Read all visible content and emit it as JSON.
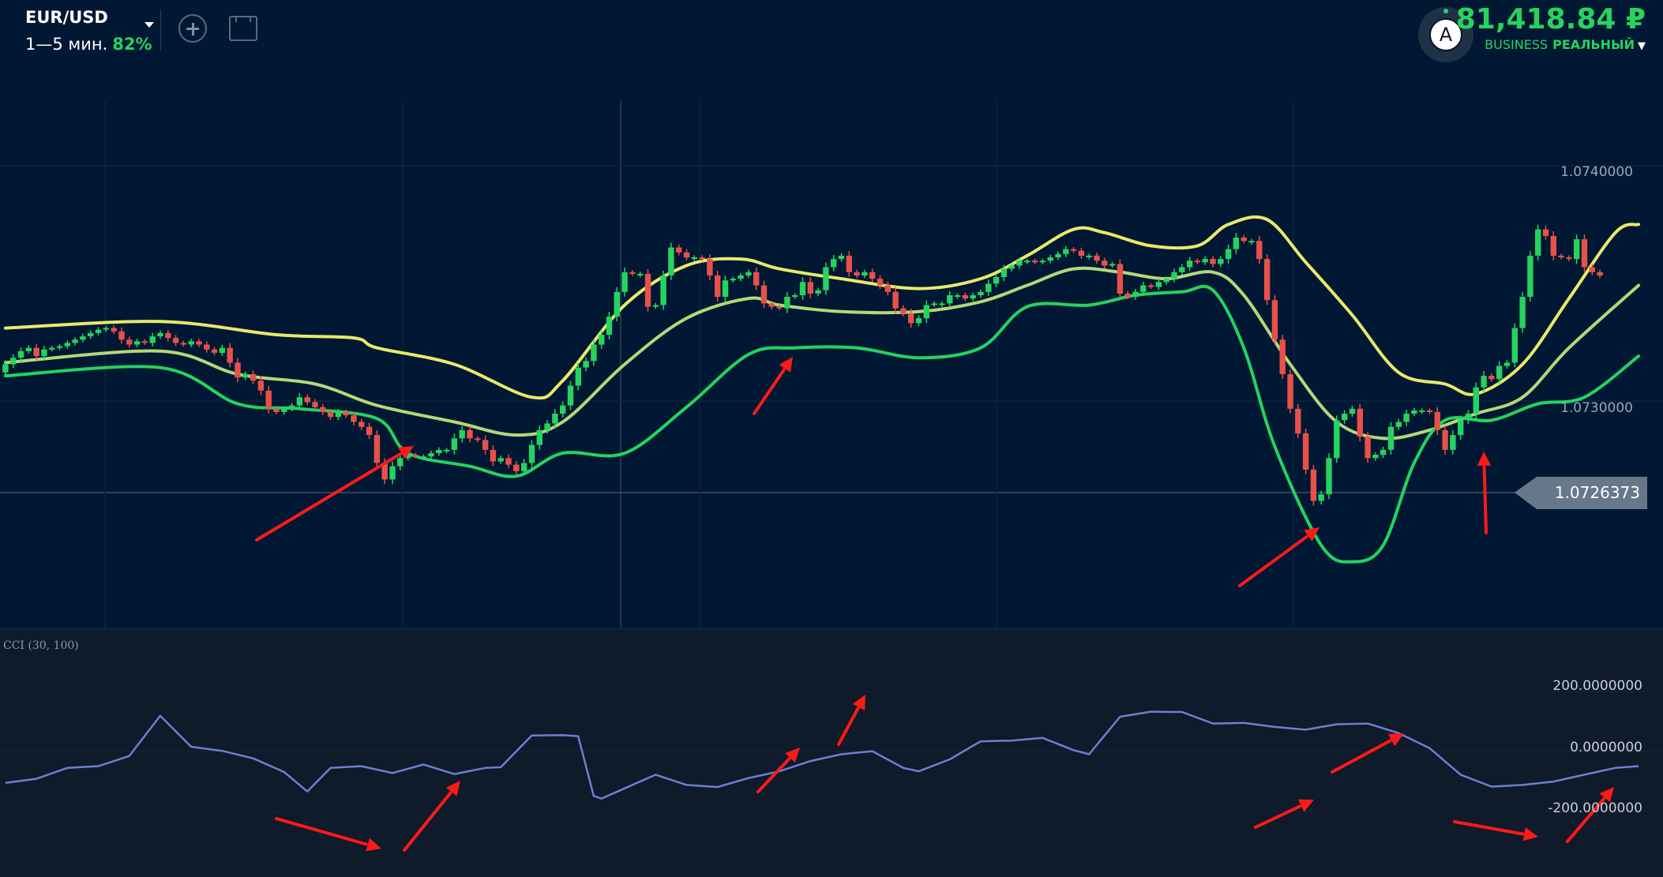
{
  "header": {
    "asset": "EUR/USD",
    "timeframe": "1—5 мин.",
    "payout": "82%",
    "balance": "81,418.84 ₽",
    "account_tier": "BUSINESS",
    "account_type": "РЕАЛЬНЫЙ",
    "avatar_letter": "A"
  },
  "colors": {
    "background": "#001833",
    "indicator_background": "#0f1a2a",
    "bullish": "#27d35f",
    "bearish": "#e8514a",
    "upper_band": "#e8ea6a",
    "middle_band": "#b6d77a",
    "lower_band": "#22d460",
    "cci_line": "#6d7fd1",
    "annotation_arrows": "#ff1a1a",
    "accent_green": "#27d35f"
  },
  "chart_data": [
    {
      "type": "candlestick",
      "title": "",
      "y_ticks": [
        "1.0740000",
        "1.0730000"
      ],
      "ylim": [
        1.0717,
        1.0749
      ],
      "current_price": "1.0726373",
      "x": [
        0,
        1,
        2,
        3,
        4,
        5,
        6,
        7,
        8,
        9,
        10,
        11,
        12,
        13,
        14,
        15,
        16,
        17,
        18,
        19,
        20,
        21,
        22,
        23,
        24,
        25,
        26,
        27,
        28,
        29,
        30,
        31,
        32,
        33,
        34,
        35,
        36,
        37,
        38,
        39,
        40,
        41,
        42,
        43,
        44,
        45,
        46,
        47,
        48,
        49,
        50,
        51,
        52,
        53,
        54,
        55,
        56,
        57,
        58,
        59,
        60,
        61,
        62,
        63,
        64,
        65,
        66,
        67,
        68,
        69,
        70,
        71,
        72,
        73,
        74,
        75,
        76,
        77,
        78,
        79,
        80,
        81,
        82,
        83,
        84,
        85,
        86,
        87,
        88,
        89,
        90,
        91,
        92,
        93,
        94,
        95,
        96,
        97,
        98,
        99,
        100,
        101,
        102,
        103,
        104,
        105,
        106,
        107,
        108,
        109,
        110,
        111,
        112,
        113,
        114,
        115,
        116,
        117,
        118,
        119,
        120,
        121,
        122,
        123,
        124,
        125,
        126,
        127,
        128,
        129,
        130,
        131,
        132,
        133,
        134,
        135,
        136,
        137,
        138,
        139,
        140,
        141,
        142,
        143,
        144,
        145,
        146,
        147,
        148,
        149,
        150,
        151,
        152,
        153,
        154,
        155,
        156,
        157,
        158,
        159,
        160,
        161,
        162,
        163,
        164,
        165,
        166,
        167,
        168,
        169,
        170,
        171,
        172,
        173,
        174,
        175,
        176,
        177,
        178,
        179,
        180,
        181,
        182,
        183,
        184,
        185,
        186,
        187,
        188,
        189,
        190,
        191,
        192,
        193,
        194,
        195,
        196,
        197,
        198,
        199,
        200,
        201,
        202,
        203,
        204,
        205,
        206,
        207,
        208,
        209,
        210,
        211
      ],
      "open": [
        1.07325,
        1.0733,
        1.07334,
        1.07338,
        1.0734,
        1.07335,
        1.07339,
        1.0734,
        1.07341,
        1.07343,
        1.07345,
        1.07347,
        1.07349,
        1.07351,
        1.07352,
        1.0735,
        1.07345,
        1.07342,
        1.07344,
        1.07343,
        1.07347,
        1.07349,
        1.07346,
        1.07343,
        1.07342,
        1.07344,
        1.07342,
        1.07339,
        1.07337,
        1.0734,
        1.07331,
        1.07322,
        1.07324,
        1.0732,
        1.07314,
        1.07303,
        1.07301,
        1.07303,
        1.07305,
        1.0731,
        1.07307,
        1.07304,
        1.07301,
        1.07298,
        1.07301,
        1.07299,
        1.07295,
        1.07292,
        1.07287,
        1.0727,
        1.0726,
        1.07268,
        1.07273,
        1.07275,
        1.07274,
        1.07274,
        1.07276,
        1.07278,
        1.07278,
        1.07285,
        1.0729,
        1.07285,
        1.07284,
        1.07278,
        1.07271,
        1.07273,
        1.07269,
        1.07265,
        1.0727,
        1.07281,
        1.0729,
        1.07294,
        1.073,
        1.07305,
        1.07317,
        1.07328,
        1.07332,
        1.07342,
        1.07348,
        1.07359,
        1.07374,
        1.07386,
        1.07385,
        1.07385,
        1.07365,
        1.07366,
        1.07384,
        1.07401,
        1.07398,
        1.07395,
        1.07395,
        1.07394,
        1.07384,
        1.07371,
        1.07381,
        1.07382,
        1.07384,
        1.07386,
        1.07378,
        1.07367,
        1.07365,
        1.07364,
        1.07371,
        1.07372,
        1.0738,
        1.07373,
        1.07375,
        1.07389,
        1.07394,
        1.07396,
        1.07386,
        1.07384,
        1.07386,
        1.07382,
        1.07378,
        1.07374,
        1.07364,
        1.07361,
        1.07355,
        1.07358,
        1.07366,
        1.07367,
        1.07367,
        1.07372,
        1.07372,
        1.0737,
        1.07372,
        1.07374,
        1.07379,
        1.07383,
        1.07388,
        1.0739,
        1.07393,
        1.07393,
        1.07392,
        1.07393,
        1.07395,
        1.07397,
        1.074,
        1.07399,
        1.07396,
        1.07396,
        1.07393,
        1.0739,
        1.07391,
        1.07373,
        1.07371,
        1.07374,
        1.07378,
        1.07377,
        1.0738,
        1.07382,
        1.07386,
        1.07389,
        1.07393,
        1.07392,
        1.07394,
        1.07391,
        1.07394,
        1.074,
        1.07407,
        1.07405,
        1.07405,
        1.07394,
        1.07369,
        1.07345,
        1.07324,
        1.07303,
        1.07288,
        1.07266,
        1.07247,
        1.07251,
        1.07273,
        1.07296,
        1.073,
        1.07303,
        1.07286,
        1.07273,
        1.07275,
        1.07278,
        1.07292,
        1.07295,
        1.073,
        1.07302,
        1.07302,
        1.07301,
        1.0729,
        1.07278,
        1.07287,
        1.07296,
        1.073,
        1.07316,
        1.07323,
        1.07321,
        1.07329,
        1.07331,
        1.07352,
        1.07371,
        1.07396,
        1.07412,
        1.07408,
        1.07396,
        1.07395,
        1.07394,
        1.07406,
        1.07389,
        1.07386
      ],
      "close": [
        1.0733,
        1.07334,
        1.07338,
        1.0734,
        1.07335,
        1.07339,
        1.0734,
        1.07341,
        1.07343,
        1.07345,
        1.07347,
        1.07349,
        1.07351,
        1.07352,
        1.0735,
        1.07345,
        1.07342,
        1.07344,
        1.07343,
        1.07347,
        1.07349,
        1.07346,
        1.07343,
        1.07342,
        1.07344,
        1.07342,
        1.07339,
        1.07337,
        1.0734,
        1.07331,
        1.07322,
        1.07324,
        1.0732,
        1.07314,
        1.07303,
        1.07301,
        1.07303,
        1.07305,
        1.0731,
        1.07307,
        1.07304,
        1.07301,
        1.07298,
        1.07301,
        1.07299,
        1.07295,
        1.07292,
        1.07287,
        1.0727,
        1.0726,
        1.07268,
        1.07273,
        1.07275,
        1.07274,
        1.07274,
        1.07276,
        1.07278,
        1.07278,
        1.07285,
        1.0729,
        1.07285,
        1.07284,
        1.07278,
        1.07271,
        1.07273,
        1.07269,
        1.07265,
        1.0727,
        1.07281,
        1.0729,
        1.07294,
        1.073,
        1.07305,
        1.07317,
        1.07328,
        1.07332,
        1.07342,
        1.07348,
        1.07359,
        1.07374,
        1.07386,
        1.07385,
        1.07385,
        1.07365,
        1.07366,
        1.07384,
        1.07401,
        1.07398,
        1.07395,
        1.07395,
        1.07394,
        1.07384,
        1.07371,
        1.07381,
        1.07382,
        1.07384,
        1.07386,
        1.07378,
        1.07367,
        1.07365,
        1.07364,
        1.07371,
        1.07372,
        1.0738,
        1.07373,
        1.07375,
        1.07389,
        1.07394,
        1.07396,
        1.07386,
        1.07384,
        1.07386,
        1.07382,
        1.07378,
        1.07374,
        1.07364,
        1.07361,
        1.07355,
        1.07358,
        1.07366,
        1.07367,
        1.07367,
        1.07372,
        1.07372,
        1.0737,
        1.07372,
        1.07374,
        1.07379,
        1.07383,
        1.07388,
        1.0739,
        1.07393,
        1.07393,
        1.07392,
        1.07393,
        1.07395,
        1.07397,
        1.074,
        1.07399,
        1.07396,
        1.07396,
        1.07393,
        1.0739,
        1.07391,
        1.07373,
        1.07371,
        1.07374,
        1.07378,
        1.07377,
        1.0738,
        1.07382,
        1.07386,
        1.07389,
        1.07393,
        1.07392,
        1.07394,
        1.07391,
        1.07394,
        1.074,
        1.07407,
        1.07405,
        1.07405,
        1.07394,
        1.07369,
        1.07345,
        1.07324,
        1.07303,
        1.07288,
        1.07266,
        1.07247,
        1.07251,
        1.07273,
        1.07296,
        1.073,
        1.07303,
        1.07286,
        1.07273,
        1.07275,
        1.07278,
        1.07292,
        1.07295,
        1.073,
        1.07302,
        1.07302,
        1.07301,
        1.0729,
        1.07278,
        1.07287,
        1.07296,
        1.073,
        1.07316,
        1.07323,
        1.07321,
        1.07329,
        1.07331,
        1.07352,
        1.07371,
        1.07396,
        1.07412,
        1.07408,
        1.07396,
        1.07395,
        1.07394,
        1.07406,
        1.07389,
        1.07386,
        1.07384
      ],
      "series": [
        {
          "name": "",
          "line": "upper_band"
        },
        {
          "name": "",
          "line": "middle_band"
        },
        {
          "name": "",
          "line": "lower_band"
        }
      ],
      "upper_band_points": [
        [
          0,
          1.07352
        ],
        [
          20,
          1.07356
        ],
        [
          35,
          1.07348
        ],
        [
          45,
          1.07346
        ],
        [
          48,
          1.0734
        ],
        [
          58,
          1.0733
        ],
        [
          68,
          1.0731
        ],
        [
          72,
          1.0732
        ],
        [
          80,
          1.07366
        ],
        [
          88,
          1.0739
        ],
        [
          95,
          1.07394
        ],
        [
          100,
          1.07388
        ],
        [
          108,
          1.07382
        ],
        [
          118,
          1.07376
        ],
        [
          126,
          1.07382
        ],
        [
          132,
          1.07396
        ],
        [
          138,
          1.07412
        ],
        [
          142,
          1.0741
        ],
        [
          148,
          1.07402
        ],
        [
          154,
          1.07402
        ],
        [
          158,
          1.07415
        ],
        [
          163,
          1.07418
        ],
        [
          168,
          1.07392
        ],
        [
          174,
          1.0736
        ],
        [
          180,
          1.07325
        ],
        [
          186,
          1.07318
        ],
        [
          190,
          1.07312
        ],
        [
          196,
          1.0733
        ],
        [
          202,
          1.0737
        ],
        [
          208,
          1.0741
        ],
        [
          211,
          1.07415
        ]
      ],
      "middle_band_points": [
        [
          0,
          1.07331
        ],
        [
          20,
          1.07338
        ],
        [
          30,
          1.07324
        ],
        [
          40,
          1.07318
        ],
        [
          48,
          1.07305
        ],
        [
          58,
          1.07295
        ],
        [
          66,
          1.07287
        ],
        [
          72,
          1.07295
        ],
        [
          80,
          1.0733
        ],
        [
          88,
          1.07358
        ],
        [
          96,
          1.0737
        ],
        [
          100,
          1.07366
        ],
        [
          108,
          1.07362
        ],
        [
          118,
          1.07362
        ],
        [
          126,
          1.07368
        ],
        [
          132,
          1.07378
        ],
        [
          138,
          1.07388
        ],
        [
          144,
          1.07386
        ],
        [
          150,
          1.07382
        ],
        [
          156,
          1.07386
        ],
        [
          160,
          1.07372
        ],
        [
          166,
          1.0733
        ],
        [
          172,
          1.07295
        ],
        [
          178,
          1.07285
        ],
        [
          184,
          1.0729
        ],
        [
          190,
          1.073
        ],
        [
          196,
          1.0731
        ],
        [
          202,
          1.0734
        ],
        [
          211,
          1.07378
        ]
      ],
      "lower_band_points": [
        [
          0,
          1.07323
        ],
        [
          20,
          1.07328
        ],
        [
          30,
          1.07306
        ],
        [
          38,
          1.07303
        ],
        [
          48,
          1.07297
        ],
        [
          52,
          1.07276
        ],
        [
          60,
          1.07268
        ],
        [
          66,
          1.07262
        ],
        [
          72,
          1.07276
        ],
        [
          80,
          1.07276
        ],
        [
          88,
          1.07304
        ],
        [
          96,
          1.07336
        ],
        [
          102,
          1.0734
        ],
        [
          110,
          1.0734
        ],
        [
          118,
          1.07334
        ],
        [
          126,
          1.0734
        ],
        [
          132,
          1.07365
        ],
        [
          140,
          1.07366
        ],
        [
          146,
          1.07372
        ],
        [
          152,
          1.07374
        ],
        [
          156,
          1.07375
        ],
        [
          160,
          1.0734
        ],
        [
          164,
          1.0728
        ],
        [
          170,
          1.0722
        ],
        [
          174,
          1.0721
        ],
        [
          178,
          1.0722
        ],
        [
          182,
          1.0727
        ],
        [
          186,
          1.07296
        ],
        [
          192,
          1.07296
        ],
        [
          198,
          1.07306
        ],
        [
          204,
          1.0731
        ],
        [
          211,
          1.07335
        ]
      ]
    },
    {
      "type": "line",
      "title": "CCI (30, 100)",
      "y_ticks": [
        "200.0000000",
        "0.0000000",
        "-200.0000000"
      ],
      "ylim": [
        -360,
        360
      ],
      "series": [
        {
          "name": "",
          "points": [
            [
              0,
              -84
            ],
            [
              4,
              -72
            ],
            [
              8,
              -40
            ],
            [
              12,
              -35
            ],
            [
              16,
              -5
            ],
            [
              20,
              113
            ],
            [
              24,
              22
            ],
            [
              28,
              10
            ],
            [
              32,
              -12
            ],
            [
              36,
              -52
            ],
            [
              39,
              -109
            ],
            [
              42,
              -40
            ],
            [
              46,
              -35
            ],
            [
              50,
              -55
            ],
            [
              54,
              -30
            ],
            [
              58,
              -58
            ],
            [
              62,
              -40
            ],
            [
              64,
              -38
            ],
            [
              68,
              55
            ],
            [
              72,
              56
            ],
            [
              74,
              53
            ],
            [
              76,
              -122
            ],
            [
              77,
              -130
            ],
            [
              80,
              -100
            ],
            [
              84,
              -60
            ],
            [
              88,
              -90
            ],
            [
              92,
              -96
            ],
            [
              96,
              -70
            ],
            [
              100,
              -50
            ],
            [
              104,
              -20
            ],
            [
              108,
              0
            ],
            [
              112,
              9
            ],
            [
              116,
              -40
            ],
            [
              118,
              -50
            ],
            [
              122,
              -15
            ],
            [
              126,
              38
            ],
            [
              130,
              40
            ],
            [
              134,
              48
            ],
            [
              138,
              12
            ],
            [
              140,
              0
            ],
            [
              144,
              110
            ],
            [
              148,
              125
            ],
            [
              150,
              124
            ],
            [
              152,
              124
            ],
            [
              156,
              90
            ],
            [
              160,
              92
            ],
            [
              164,
              80
            ],
            [
              168,
              72
            ],
            [
              172,
              88
            ],
            [
              176,
              90
            ],
            [
              180,
              62
            ],
            [
              184,
              18
            ],
            [
              188,
              -60
            ],
            [
              192,
              -95
            ],
            [
              196,
              -90
            ],
            [
              200,
              -80
            ],
            [
              204,
              -60
            ],
            [
              208,
              -40
            ],
            [
              211,
              -35
            ]
          ]
        }
      ]
    }
  ],
  "annotations": {
    "arrow_count": 12
  }
}
